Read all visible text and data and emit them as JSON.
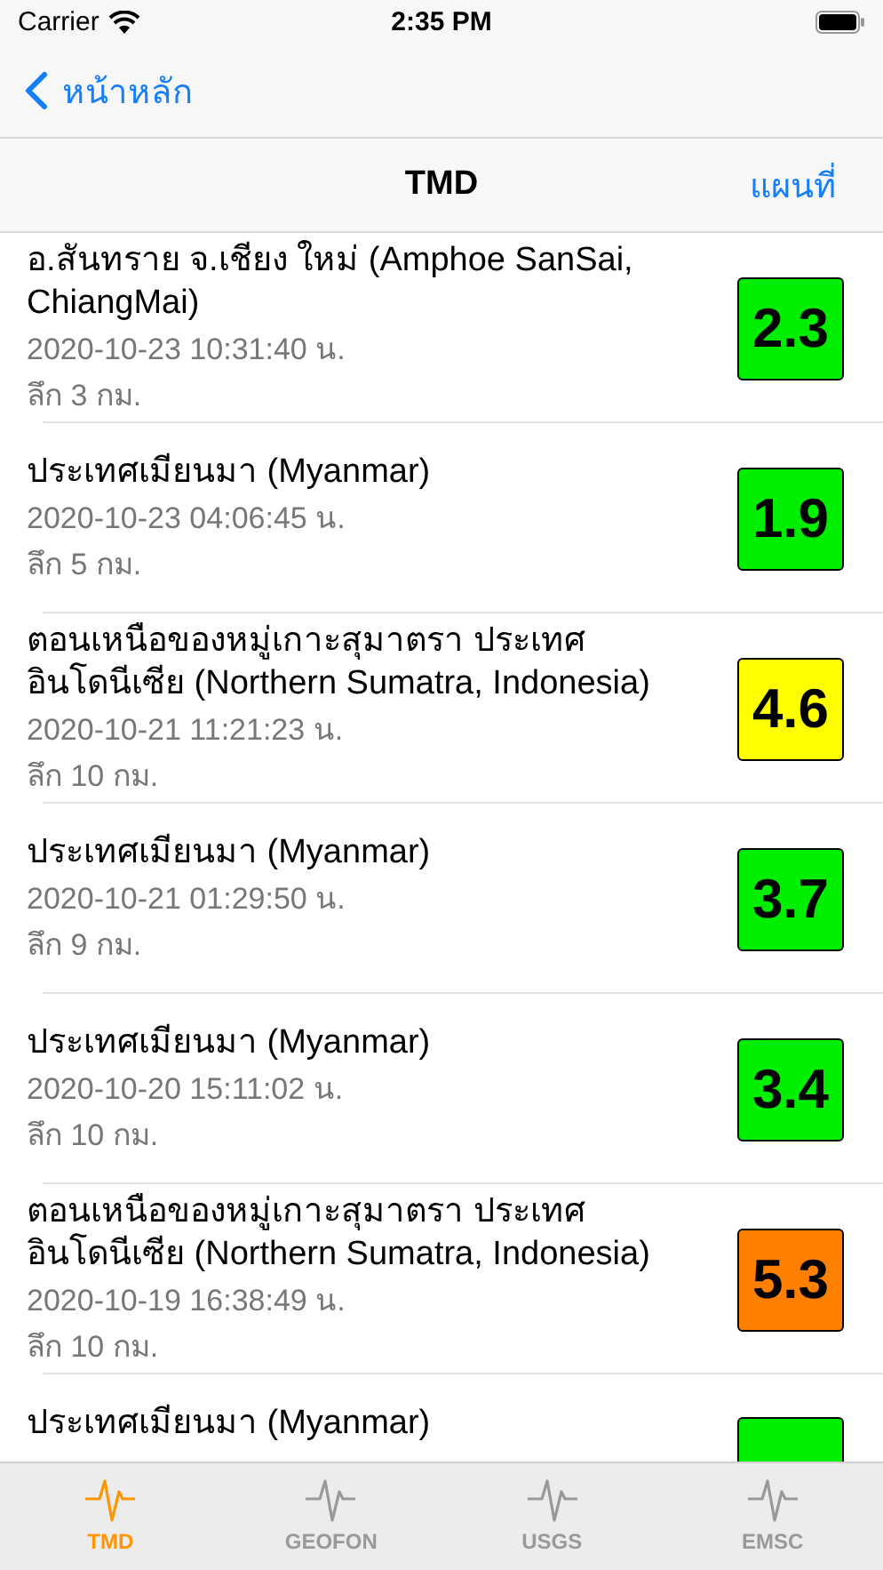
{
  "status_bar": {
    "carrier": "Carrier",
    "time": "2:35 PM"
  },
  "nav": {
    "back": "หน้าหลัก",
    "title": "TMD",
    "action": "แผนที่"
  },
  "quakes": [
    {
      "title": "อ.สันทราย จ.เชียง ใหม่ (Amphoe SanSai, ChiangMai)",
      "time": "2020-10-23 10:31:40 น.",
      "depth": "ลึก 3 กม.",
      "magnitude": "2.3",
      "color": "#00ee00"
    },
    {
      "title": "ประเทศเมียนมา (Myanmar)",
      "time": "2020-10-23 04:06:45 น.",
      "depth": "ลึก 5 กม.",
      "magnitude": "1.9",
      "color": "#00ee00"
    },
    {
      "title": "ตอนเหนือของหมู่เกาะสุมาตรา ประเทศอินโดนีเซีย (Northern Sumatra, Indonesia)",
      "time": "2020-10-21 11:21:23 น.",
      "depth": "ลึก 10 กม.",
      "magnitude": "4.6",
      "color": "#ffff00"
    },
    {
      "title": "ประเทศเมียนมา (Myanmar)",
      "time": "2020-10-21 01:29:50 น.",
      "depth": "ลึก 9 กม.",
      "magnitude": "3.7",
      "color": "#00ee00"
    },
    {
      "title": "ประเทศเมียนมา (Myanmar)",
      "time": "2020-10-20 15:11:02 น.",
      "depth": "ลึก 10 กม.",
      "magnitude": "3.4",
      "color": "#00ee00"
    },
    {
      "title": "ตอนเหนือของหมู่เกาะสุมาตรา ประเทศอินโดนีเซีย (Northern Sumatra, Indonesia)",
      "time": "2020-10-19 16:38:49 น.",
      "depth": "ลึก 10 กม.",
      "magnitude": "5.3",
      "color": "#ff8000"
    },
    {
      "title": "ประเทศเมียนมา (Myanmar)",
      "color": "#00ee00"
    }
  ],
  "tabs": [
    {
      "label": "TMD",
      "selected": true
    },
    {
      "label": "GEOFON",
      "selected": false
    },
    {
      "label": "USGS",
      "selected": false
    },
    {
      "label": "EMSC",
      "selected": false
    }
  ]
}
